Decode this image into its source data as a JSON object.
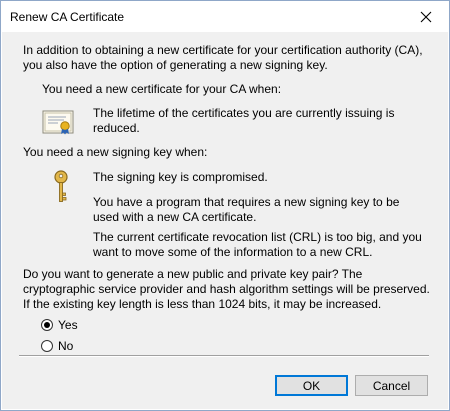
{
  "window": {
    "title": "Renew CA Certificate",
    "close_icon": "close-icon"
  },
  "content": {
    "intro": "In addition to obtaining a new certificate for your certification authority (CA), you also have the option of generating a new signing key.",
    "new_cert_heading": "You need a new certificate for your CA when:",
    "new_cert_reason": "The lifetime of the certificates you are currently issuing is reduced.",
    "certificate_icon": "certificate-icon",
    "new_key_heading": "You need a new signing key when:",
    "key_icon": "key-icon",
    "new_key_reasons": [
      "The signing key is compromised.",
      "You have a program that requires a new signing key to be used with a new CA certificate.",
      "The current certificate revocation list (CRL) is too big, and you want to move some of the information to a new CRL."
    ],
    "question": "Do you want to generate a new public and private key pair? The cryptographic service provider and hash algorithm settings will be preserved.  If the existing key length is less than 1024 bits, it may be increased."
  },
  "options": {
    "yes_label": "Yes",
    "no_label": "No",
    "selected": "Yes"
  },
  "buttons": {
    "ok_label": "OK",
    "cancel_label": "Cancel"
  }
}
